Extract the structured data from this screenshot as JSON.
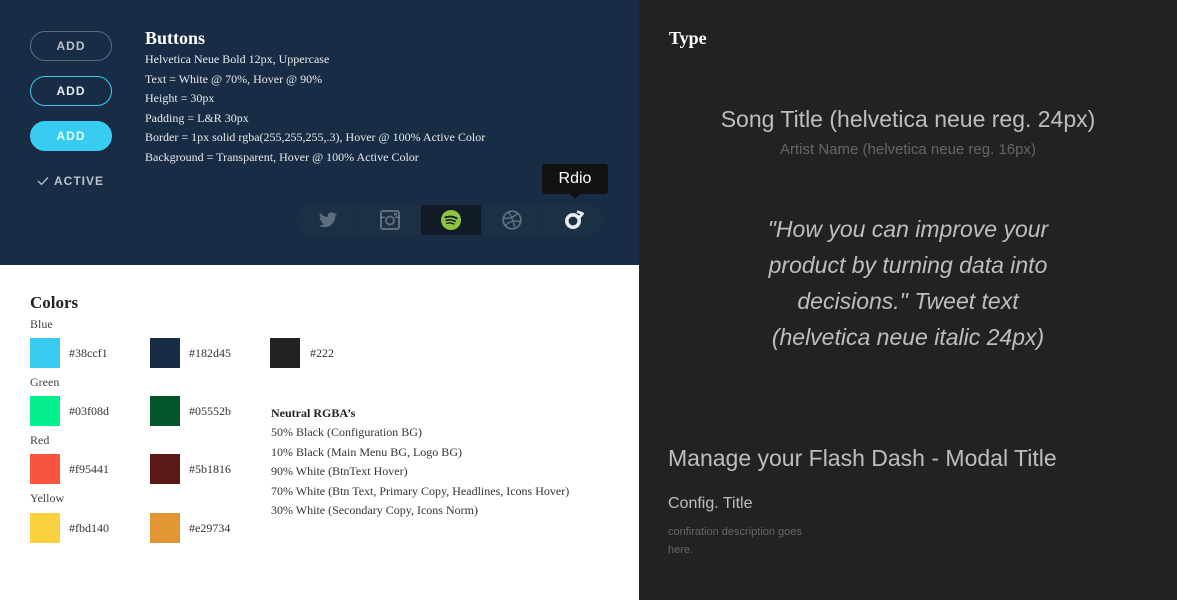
{
  "buttons": {
    "title": "Buttons",
    "normal_label": "ADD",
    "hover_label": "ADD",
    "active_label": "ADD",
    "active_state_label": "ACTIVE",
    "specs": [
      "Helvetica Neue Bold 12px, Uppercase",
      "Text = White @ 70%, Hover @ 90%",
      "Height = 30px",
      "Padding = L&R 30px",
      "Border = 1px solid rgba(255,255,255,.3), Hover @ 100% Active Color",
      "Background = Transparent, Hover @ 100% Active Color"
    ],
    "social": {
      "items": [
        "twitter-icon",
        "instagram-icon",
        "spotify-icon",
        "dribbble-icon",
        "rdio-icon"
      ],
      "selected": "spotify-icon",
      "tooltip": "Rdio"
    }
  },
  "colors": {
    "title": "Colors",
    "groups": {
      "blue": {
        "label": "Blue",
        "swatches": [
          {
            "hex": "#38ccf1"
          },
          {
            "hex": "#182d45"
          },
          {
            "hex": "#222"
          }
        ]
      },
      "green": {
        "label": "Green",
        "swatches": [
          {
            "hex": "#03f08d"
          },
          {
            "hex": "#05552b"
          }
        ]
      },
      "red": {
        "label": "Red",
        "swatches": [
          {
            "hex": "#f95441"
          },
          {
            "hex": "#5b1816"
          }
        ]
      },
      "yellow": {
        "label": "Yellow",
        "swatches": [
          {
            "hex": "#fbd140"
          },
          {
            "hex": "#e29734"
          }
        ]
      }
    },
    "neutral": {
      "title": "Neutral RGBA’s",
      "items": [
        "50% Black (Configuration BG)",
        "10% Black (Main Menu BG, Logo BG)",
        "90% White (BtnText Hover)",
        "70% White (Btn Text, Primary Copy, Headlines, Icons Hover)",
        "30% White (Secondary Copy, Icons Norm)"
      ]
    }
  },
  "type": {
    "title": "Type",
    "song_title": "Song Title (helvetica neue reg. 24px)",
    "artist_name": "Artist Name (helvetica neue reg. 16px)",
    "tweet_text": "\"How you can improve your product by turning data into decisions.\" Tweet text (helvetica neue italic 24px)",
    "modal_title": "Manage your Flash Dash - Modal Title",
    "config_title": "Config. Title",
    "config_description": "confiration description goes here."
  },
  "palette": {
    "active_blue": "#38ccf1",
    "navy": "#182d45",
    "dark": "#222",
    "spotify_green": "#8cc63f"
  }
}
